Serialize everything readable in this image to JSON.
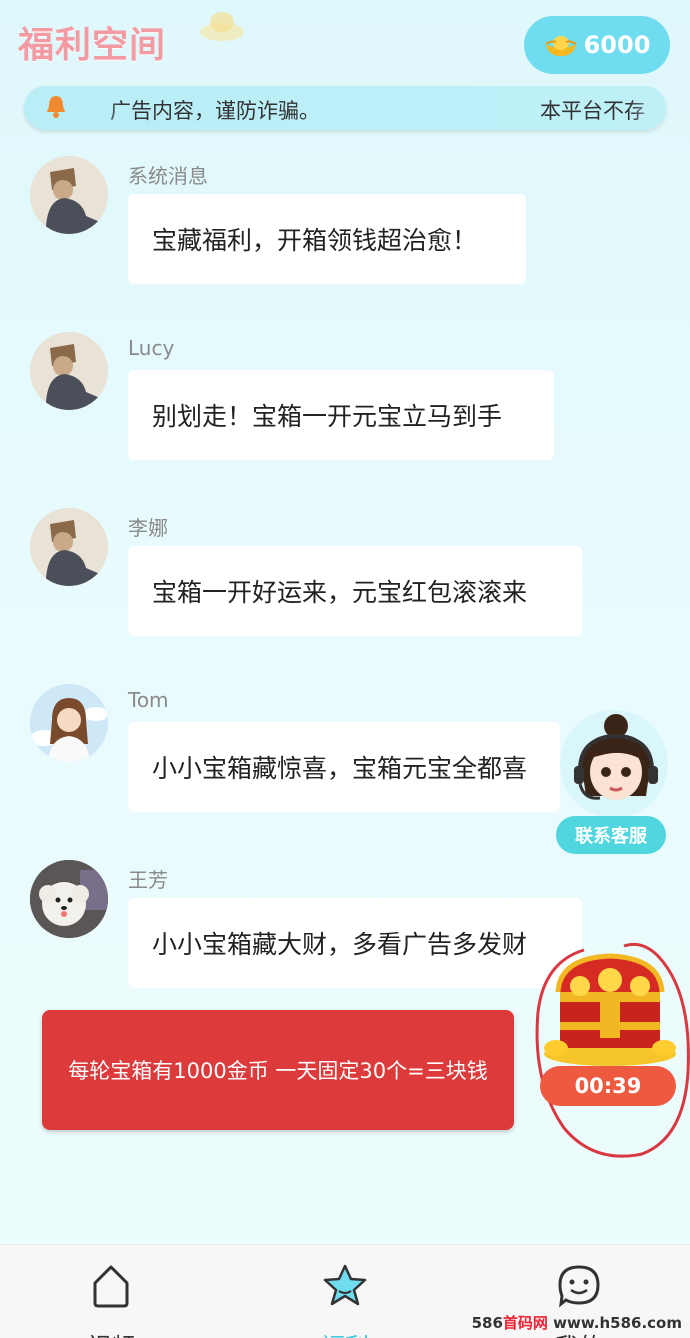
{
  "header": {
    "logo_text": "福利空间",
    "coin_balance": "6000"
  },
  "notice": {
    "text_left": "广告内容，谨防诈骗。",
    "text_right": "本平台不存"
  },
  "messages": [
    {
      "name": "系统消息",
      "text": "宝藏福利，开箱领钱超治愈！"
    },
    {
      "name": "Lucy",
      "text": "别划走！宝箱一开元宝立马到手"
    },
    {
      "name": "李娜",
      "text": "宝箱一开好运来，元宝红包滚滚来"
    },
    {
      "name": "Tom",
      "text": "小小宝箱藏惊喜，宝箱元宝全都喜"
    },
    {
      "name": "王芳",
      "text": "小小宝箱藏大财，多看广告多发财"
    }
  ],
  "banner": {
    "text": "每轮宝箱有1000金币 一天固定30个=三块钱"
  },
  "customer_service": {
    "label": "联系客服"
  },
  "treasure": {
    "timer": "00:39"
  },
  "tabs": [
    {
      "label": "视频",
      "icon": "home-icon"
    },
    {
      "label": "福利",
      "icon": "star-icon"
    },
    {
      "label": "我的",
      "icon": "smile-icon"
    }
  ],
  "watermark": {
    "text_prefix": "586",
    "text_red": "首码网",
    "text_suffix": " www.h586.com"
  },
  "colors": {
    "accent": "#3cc6df",
    "banner": "#dd3b3b",
    "timer": "#ee5a3f",
    "coin_pill": "#6fdcf0"
  }
}
